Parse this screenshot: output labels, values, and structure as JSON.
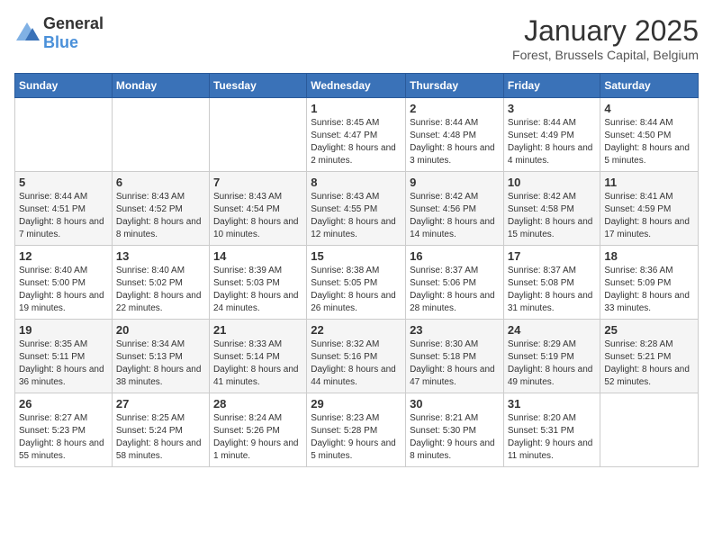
{
  "header": {
    "logo_general": "General",
    "logo_blue": "Blue",
    "main_title": "January 2025",
    "subtitle": "Forest, Brussels Capital, Belgium"
  },
  "calendar": {
    "days_of_week": [
      "Sunday",
      "Monday",
      "Tuesday",
      "Wednesday",
      "Thursday",
      "Friday",
      "Saturday"
    ],
    "weeks": [
      [
        {
          "day": "",
          "info": ""
        },
        {
          "day": "",
          "info": ""
        },
        {
          "day": "",
          "info": ""
        },
        {
          "day": "1",
          "info": "Sunrise: 8:45 AM\nSunset: 4:47 PM\nDaylight: 8 hours and 2 minutes."
        },
        {
          "day": "2",
          "info": "Sunrise: 8:44 AM\nSunset: 4:48 PM\nDaylight: 8 hours and 3 minutes."
        },
        {
          "day": "3",
          "info": "Sunrise: 8:44 AM\nSunset: 4:49 PM\nDaylight: 8 hours and 4 minutes."
        },
        {
          "day": "4",
          "info": "Sunrise: 8:44 AM\nSunset: 4:50 PM\nDaylight: 8 hours and 5 minutes."
        }
      ],
      [
        {
          "day": "5",
          "info": "Sunrise: 8:44 AM\nSunset: 4:51 PM\nDaylight: 8 hours and 7 minutes."
        },
        {
          "day": "6",
          "info": "Sunrise: 8:43 AM\nSunset: 4:52 PM\nDaylight: 8 hours and 8 minutes."
        },
        {
          "day": "7",
          "info": "Sunrise: 8:43 AM\nSunset: 4:54 PM\nDaylight: 8 hours and 10 minutes."
        },
        {
          "day": "8",
          "info": "Sunrise: 8:43 AM\nSunset: 4:55 PM\nDaylight: 8 hours and 12 minutes."
        },
        {
          "day": "9",
          "info": "Sunrise: 8:42 AM\nSunset: 4:56 PM\nDaylight: 8 hours and 14 minutes."
        },
        {
          "day": "10",
          "info": "Sunrise: 8:42 AM\nSunset: 4:58 PM\nDaylight: 8 hours and 15 minutes."
        },
        {
          "day": "11",
          "info": "Sunrise: 8:41 AM\nSunset: 4:59 PM\nDaylight: 8 hours and 17 minutes."
        }
      ],
      [
        {
          "day": "12",
          "info": "Sunrise: 8:40 AM\nSunset: 5:00 PM\nDaylight: 8 hours and 19 minutes."
        },
        {
          "day": "13",
          "info": "Sunrise: 8:40 AM\nSunset: 5:02 PM\nDaylight: 8 hours and 22 minutes."
        },
        {
          "day": "14",
          "info": "Sunrise: 8:39 AM\nSunset: 5:03 PM\nDaylight: 8 hours and 24 minutes."
        },
        {
          "day": "15",
          "info": "Sunrise: 8:38 AM\nSunset: 5:05 PM\nDaylight: 8 hours and 26 minutes."
        },
        {
          "day": "16",
          "info": "Sunrise: 8:37 AM\nSunset: 5:06 PM\nDaylight: 8 hours and 28 minutes."
        },
        {
          "day": "17",
          "info": "Sunrise: 8:37 AM\nSunset: 5:08 PM\nDaylight: 8 hours and 31 minutes."
        },
        {
          "day": "18",
          "info": "Sunrise: 8:36 AM\nSunset: 5:09 PM\nDaylight: 8 hours and 33 minutes."
        }
      ],
      [
        {
          "day": "19",
          "info": "Sunrise: 8:35 AM\nSunset: 5:11 PM\nDaylight: 8 hours and 36 minutes."
        },
        {
          "day": "20",
          "info": "Sunrise: 8:34 AM\nSunset: 5:13 PM\nDaylight: 8 hours and 38 minutes."
        },
        {
          "day": "21",
          "info": "Sunrise: 8:33 AM\nSunset: 5:14 PM\nDaylight: 8 hours and 41 minutes."
        },
        {
          "day": "22",
          "info": "Sunrise: 8:32 AM\nSunset: 5:16 PM\nDaylight: 8 hours and 44 minutes."
        },
        {
          "day": "23",
          "info": "Sunrise: 8:30 AM\nSunset: 5:18 PM\nDaylight: 8 hours and 47 minutes."
        },
        {
          "day": "24",
          "info": "Sunrise: 8:29 AM\nSunset: 5:19 PM\nDaylight: 8 hours and 49 minutes."
        },
        {
          "day": "25",
          "info": "Sunrise: 8:28 AM\nSunset: 5:21 PM\nDaylight: 8 hours and 52 minutes."
        }
      ],
      [
        {
          "day": "26",
          "info": "Sunrise: 8:27 AM\nSunset: 5:23 PM\nDaylight: 8 hours and 55 minutes."
        },
        {
          "day": "27",
          "info": "Sunrise: 8:25 AM\nSunset: 5:24 PM\nDaylight: 8 hours and 58 minutes."
        },
        {
          "day": "28",
          "info": "Sunrise: 8:24 AM\nSunset: 5:26 PM\nDaylight: 9 hours and 1 minute."
        },
        {
          "day": "29",
          "info": "Sunrise: 8:23 AM\nSunset: 5:28 PM\nDaylight: 9 hours and 5 minutes."
        },
        {
          "day": "30",
          "info": "Sunrise: 8:21 AM\nSunset: 5:30 PM\nDaylight: 9 hours and 8 minutes."
        },
        {
          "day": "31",
          "info": "Sunrise: 8:20 AM\nSunset: 5:31 PM\nDaylight: 9 hours and 11 minutes."
        },
        {
          "day": "",
          "info": ""
        }
      ]
    ]
  }
}
